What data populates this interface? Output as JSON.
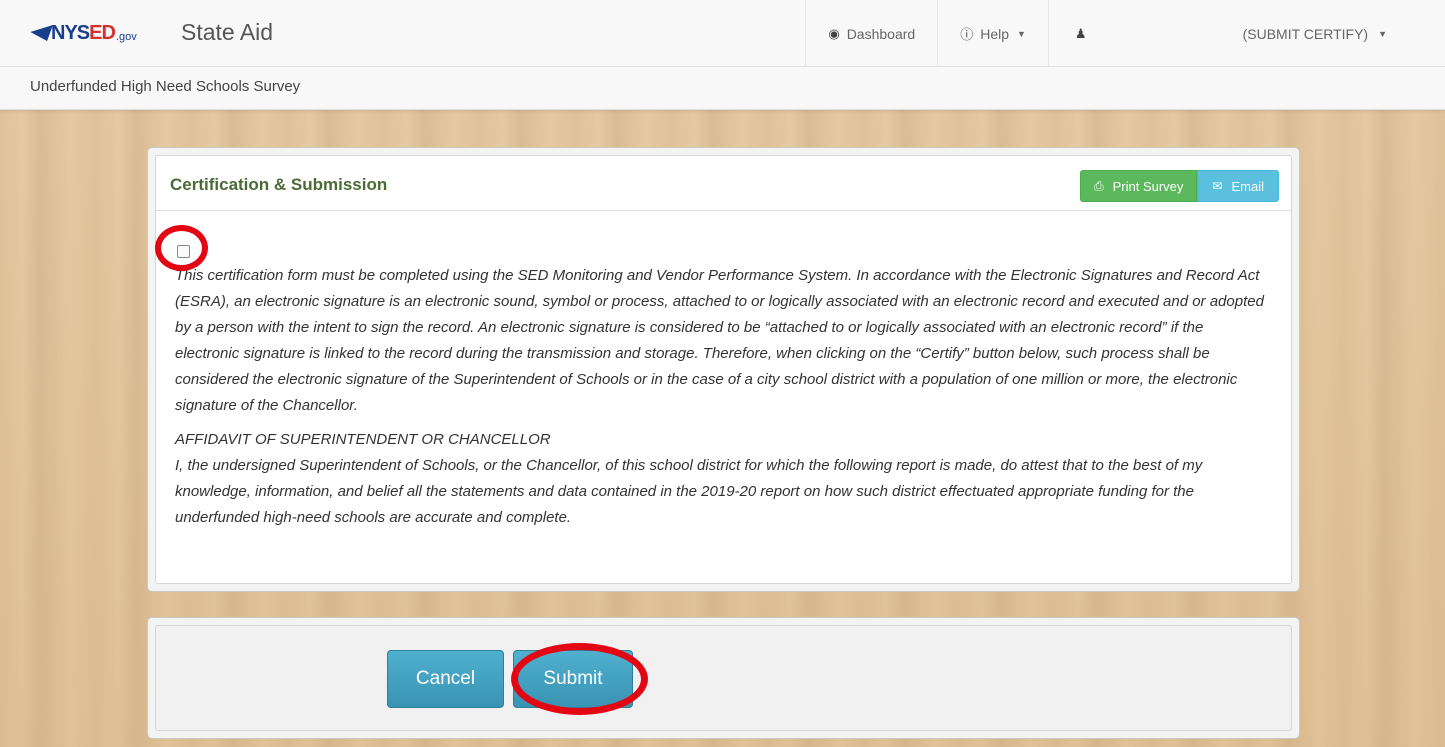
{
  "navbar": {
    "logo_nys": "NYS",
    "logo_ed": "ED",
    "logo_gov": ".gov",
    "app_title": "State Aid",
    "dashboard_label": "Dashboard",
    "help_label": "Help",
    "user_label": "(SUBMIT CERTIFY)"
  },
  "subbar": {
    "title": "Underfunded High Need Schools Survey"
  },
  "panel": {
    "title": "Certification & Submission",
    "print_label": "Print Survey",
    "email_label": "Email",
    "certify_text": "This certification form must be completed using the SED Monitoring and Vendor Performance System.  In accordance with the Electronic Signatures and Record Act (ESRA), an electronic signature is an electronic sound, symbol or process, attached to or logically associated with an electronic record and executed and or adopted by a person with the intent to sign the record. An electronic signature is considered to be “attached to or logically associated with an electronic record” if the electronic signature is linked to the record during the transmission and storage. Therefore, when clicking on the “Certify” button below, such process shall be considered the electronic signature of the Superintendent of Schools or in the case of a city school district with a population of one million or more, the electronic signature of the Chancellor.",
    "affidavit_heading": "AFFIDAVIT OF SUPERINTENDENT OR CHANCELLOR",
    "affidavit_text": "I, the undersigned Superintendent of Schools, or the Chancellor, of this school district for which the following report is made, do attest that to the best of my knowledge, information, and belief all the statements and data contained in the 2019-20 report on how such district effectuated appropriate funding for the underfunded high-need schools are accurate and complete."
  },
  "footer": {
    "cancel_label": "Cancel",
    "submit_label": "Submit"
  },
  "icons": {
    "dashboard": "tachometer-icon",
    "help": "info-circle-icon",
    "user": "user-icon",
    "print": "print-icon",
    "email": "envelope-icon"
  },
  "colors": {
    "annotation": "#e30613",
    "panel_title": "#4a6b34",
    "print_button": "#5cb85c",
    "email_button": "#5bc0de",
    "action_button": "#3a94b3"
  }
}
